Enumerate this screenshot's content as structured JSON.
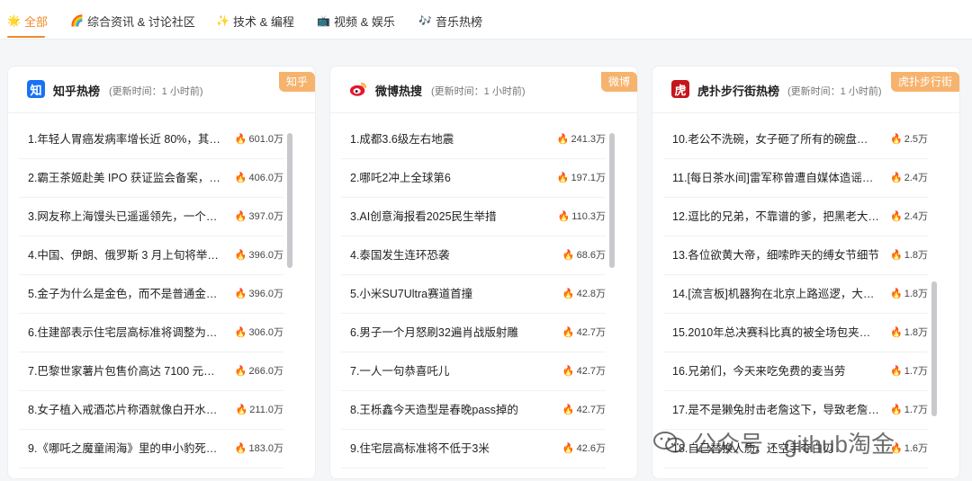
{
  "tabs": [
    {
      "icon": "🌟",
      "label": "全部",
      "active": true
    },
    {
      "icon": "🌈",
      "label": "综合资讯 & 讨论社区",
      "active": false
    },
    {
      "icon": "✨",
      "label": "技术 & 编程",
      "active": false
    },
    {
      "icon": "📺",
      "label": "视频 & 娱乐",
      "active": false
    },
    {
      "icon": "🎶",
      "label": "音乐热榜",
      "active": false
    }
  ],
  "cards": [
    {
      "logo": "知",
      "logo_color": "#1772f6",
      "title": "知乎热榜",
      "update": "(更新时间：1 小时前)",
      "badge": "知乎",
      "items": [
        {
          "title": "1.年轻人胃癌发病率增长近 80%，其…",
          "heat": "601.0万"
        },
        {
          "title": "2.霸王茶姬赴美 IPO 获证监会备案，…",
          "heat": "406.0万"
        },
        {
          "title": "3.网友称上海馒头已遥遥领先，一个…",
          "heat": "397.0万"
        },
        {
          "title": "4.中国、伊朗、俄罗斯 3 月上旬将举…",
          "heat": "396.0万"
        },
        {
          "title": "5.金子为什么是金色，而不是普通金…",
          "heat": "396.0万"
        },
        {
          "title": "6.住建部表示住宅层高标准将调整为…",
          "heat": "306.0万"
        },
        {
          "title": "7.巴黎世家薯片包售价高达 7100 元…",
          "heat": "266.0万"
        },
        {
          "title": "8.女子植入戒酒芯片称酒就像白开水…",
          "heat": "211.0万"
        },
        {
          "title": "9.《哪吒之魔童闹海》里的申小豹死…",
          "heat": "183.0万"
        }
      ]
    },
    {
      "logo": "微",
      "logo_color": "#e6162d",
      "title": "微博热搜",
      "update": "(更新时间：1 小时前)",
      "badge": "微博",
      "items": [
        {
          "title": "1.成都3.6级左右地震",
          "heat": "241.3万"
        },
        {
          "title": "2.哪吒2冲上全球第6",
          "heat": "197.1万"
        },
        {
          "title": "3.AI创意海报看2025民生举措",
          "heat": "110.3万"
        },
        {
          "title": "4.泰国发生连环恐袭",
          "heat": "68.6万"
        },
        {
          "title": "5.小米SU7Ultra赛道首撞",
          "heat": "42.8万"
        },
        {
          "title": "6.男子一个月怒刷32遍肖战版射雕",
          "heat": "42.7万"
        },
        {
          "title": "7.一人一句恭喜吒儿",
          "heat": "42.7万"
        },
        {
          "title": "8.王栎鑫今天造型是春晚pass掉的",
          "heat": "42.7万"
        },
        {
          "title": "9.住宅层高标准将不低于3米",
          "heat": "42.6万"
        }
      ]
    },
    {
      "logo": "虎",
      "logo_color": "#c4161c",
      "title": "虎扑步行街热榜",
      "update": "(更新时间：1 小时前)",
      "badge": "虎扑步行街",
      "items": [
        {
          "title": "10.老公不洗碗，女子砸了所有的碗盘…",
          "heat": "2.5万"
        },
        {
          "title": "11.[每日茶水间]雷军称曾遭自媒体造谣…",
          "heat": "2.4万"
        },
        {
          "title": "12.逗比的兄弟，不靠谱的爹，把黑老大…",
          "heat": "2.4万"
        },
        {
          "title": "13.各位欲黄大帝，细嗦昨天的缚女节细节",
          "heat": "1.8万"
        },
        {
          "title": "14.[流言板]机器狗在北京上路巡逻，大…",
          "heat": "1.8万"
        },
        {
          "title": "15.2010年总决赛科比真的被全场包夹了…",
          "heat": "1.8万"
        },
        {
          "title": "16.兄弟们，今天来吃免费的麦当劳",
          "heat": "1.7万"
        },
        {
          "title": "17.是不是獭兔肘击老詹这下，导致老詹…",
          "heat": "1.7万"
        },
        {
          "title": "18.自己替换人质，还空手夺白刃",
          "heat": "1.6万"
        }
      ]
    }
  ],
  "watermark": "公众号 · github淘金"
}
